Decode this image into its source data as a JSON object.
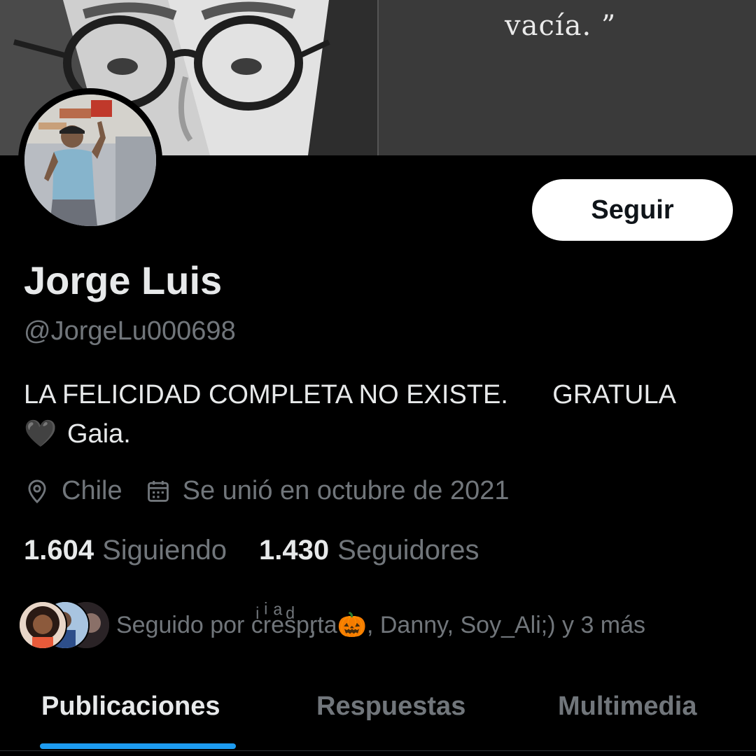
{
  "banner": {
    "quote_text": "vacía. ”"
  },
  "profile": {
    "display_name": "Jorge Luis",
    "handle": "@JorgeLu000698",
    "bio_line1": "LA FELICIDAD COMPLETA NO EXISTE.      GRATULA",
    "bio_heart": "🖤",
    "bio_line2": "Gaia.",
    "location": "Chile",
    "joined": "Se unió en octubre de 2021",
    "follow_label": "Seguir"
  },
  "stats": {
    "following_count": "1.604",
    "following_label": "Siguiendo",
    "followers_count": "1.430",
    "followers_label": "Seguidores"
  },
  "followed_by": {
    "text": "Seguido por cͥrͥeͣsͩpᶉta🎃, Danny, Soy_Ali;) y 3 más"
  },
  "tabs": [
    {
      "label": "Publicaciones",
      "active": true
    },
    {
      "label": "Respuestas",
      "active": false
    },
    {
      "label": "Multimedia",
      "active": false
    }
  ],
  "colors": {
    "accent": "#1d9bf0",
    "text_primary": "#e7e9ea",
    "text_secondary": "#71767b",
    "background": "#000000"
  },
  "icons": {
    "location": "location-pin-icon",
    "joined": "calendar-icon"
  }
}
